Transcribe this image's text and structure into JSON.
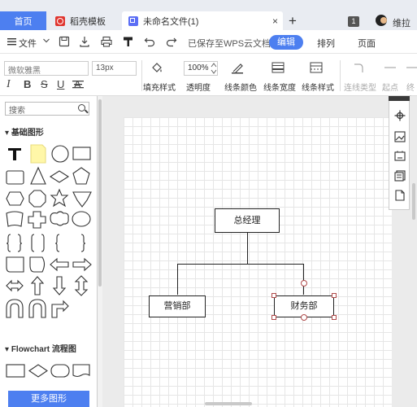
{
  "tabs": {
    "home": "首页",
    "templates": "稻壳模板",
    "document": "未命名文件(1)",
    "close_glyph": "×",
    "add_glyph": "+"
  },
  "user": {
    "badge": "1",
    "name": "维拉"
  },
  "menubar": {
    "file": "文件",
    "saved_status": "已保存至WPS云文档",
    "edit": "编辑",
    "arrange": "排列",
    "page": "页面"
  },
  "toolbar": {
    "font_name": "微软雅黑",
    "font_size": "13px",
    "fmt_italic": "I",
    "fmt_bold": "B",
    "fmt_strike": "S",
    "fmt_underline": "U",
    "fmt_text": "A",
    "zoom": "100%",
    "fill_style": "填充样式",
    "opacity": "透明度",
    "line_color": "线条颜色",
    "line_width": "线条宽度",
    "line_style": "线条样式",
    "connector_type": "连线类型",
    "start_point": "起点",
    "end_point": "终点"
  },
  "left_panel": {
    "search_placeholder": "搜索",
    "basic_shapes": "基础图形",
    "flowchart": "Flowchart 流程图",
    "more_shapes": "更多图形"
  },
  "diagram": {
    "nodes": {
      "gm": "总经理",
      "marketing": "营销部",
      "finance": "财务部"
    }
  },
  "colors": {
    "accent": "#4d7ff0",
    "tab_bg": "#e9ecf2",
    "handle": "#b04a4a"
  }
}
